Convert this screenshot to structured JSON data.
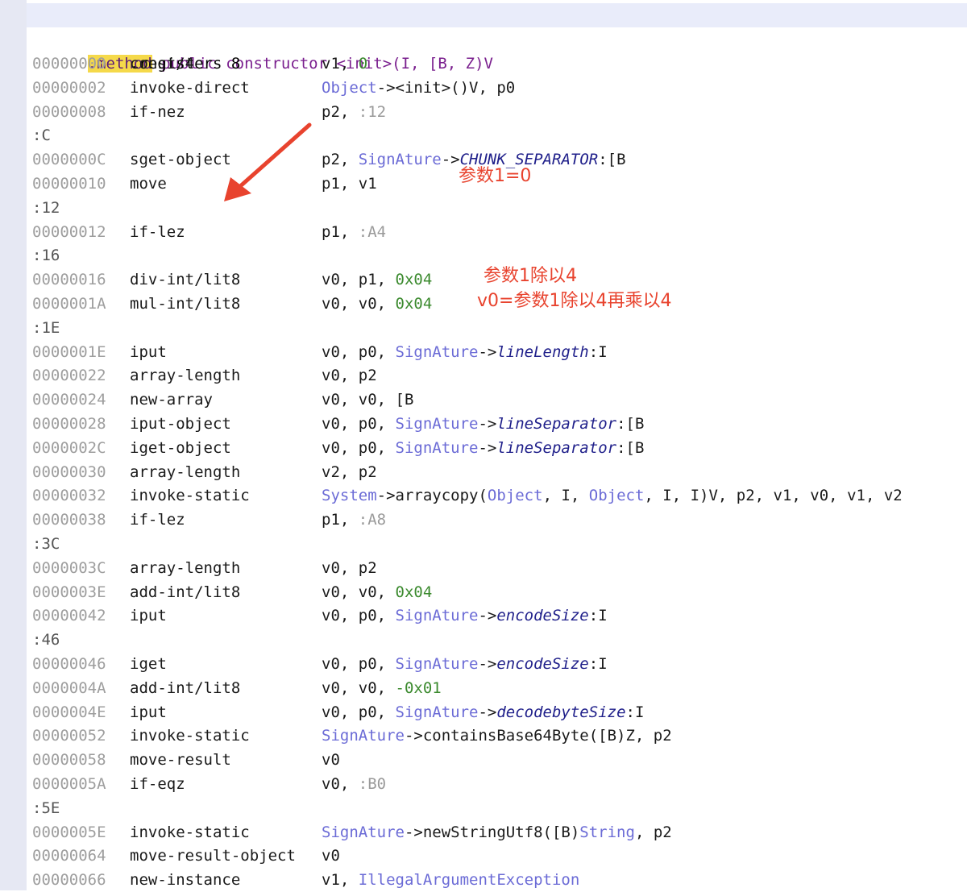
{
  "header": {
    "directive": ".method",
    "signature": " public constructor <init>(I, [B, Z)V",
    "registers": ".registers 8"
  },
  "rows": [
    {
      "addr": "00000000",
      "op": "const/4",
      "args": [
        {
          "t": "v1, "
        },
        {
          "t": "0",
          "c": "num"
        }
      ]
    },
    {
      "addr": "00000002",
      "op": "invoke-direct",
      "args": [
        {
          "t": "Object",
          "c": "cls"
        },
        {
          "t": "-><init>()V, p0"
        }
      ]
    },
    {
      "addr": "00000008",
      "op": "if-nez",
      "args": [
        {
          "t": "p2, "
        },
        {
          "t": ":12",
          "c": "lbl"
        }
      ]
    },
    {
      "label": ":C"
    },
    {
      "addr": "0000000C",
      "op": "sget-object",
      "args": [
        {
          "t": "p2, "
        },
        {
          "t": "SignAture",
          "c": "cls"
        },
        {
          "t": "->"
        },
        {
          "t": "CHUNK_SEPARATOR",
          "c": "fld"
        },
        {
          "t": ":[B"
        }
      ]
    },
    {
      "addr": "00000010",
      "op": "move",
      "args": [
        {
          "t": "p1, v1"
        }
      ]
    },
    {
      "label": ":12"
    },
    {
      "addr": "00000012",
      "op": "if-lez",
      "args": [
        {
          "t": "p1, "
        },
        {
          "t": ":A4",
          "c": "lbl"
        }
      ]
    },
    {
      "label": ":16"
    },
    {
      "addr": "00000016",
      "op": "div-int/lit8",
      "args": [
        {
          "t": "v0, p1, "
        },
        {
          "t": "0x04",
          "c": "num"
        }
      ]
    },
    {
      "addr": "0000001A",
      "op": "mul-int/lit8",
      "args": [
        {
          "t": "v0, v0, "
        },
        {
          "t": "0x04",
          "c": "num"
        }
      ]
    },
    {
      "label": ":1E"
    },
    {
      "addr": "0000001E",
      "op": "iput",
      "args": [
        {
          "t": "v0, p0, "
        },
        {
          "t": "SignAture",
          "c": "cls"
        },
        {
          "t": "->"
        },
        {
          "t": "lineLength",
          "c": "fld"
        },
        {
          "t": ":I"
        }
      ]
    },
    {
      "addr": "00000022",
      "op": "array-length",
      "args": [
        {
          "t": "v0, p2"
        }
      ]
    },
    {
      "addr": "00000024",
      "op": "new-array",
      "args": [
        {
          "t": "v0, v0, [B"
        }
      ]
    },
    {
      "addr": "00000028",
      "op": "iput-object",
      "args": [
        {
          "t": "v0, p0, "
        },
        {
          "t": "SignAture",
          "c": "cls"
        },
        {
          "t": "->"
        },
        {
          "t": "lineSeparator",
          "c": "fld"
        },
        {
          "t": ":[B"
        }
      ]
    },
    {
      "addr": "0000002C",
      "op": "iget-object",
      "args": [
        {
          "t": "v0, p0, "
        },
        {
          "t": "SignAture",
          "c": "cls"
        },
        {
          "t": "->"
        },
        {
          "t": "lineSeparator",
          "c": "fld"
        },
        {
          "t": ":[B"
        }
      ]
    },
    {
      "addr": "00000030",
      "op": "array-length",
      "args": [
        {
          "t": "v2, p2"
        }
      ]
    },
    {
      "addr": "00000032",
      "op": "invoke-static",
      "args": [
        {
          "t": "System",
          "c": "cls"
        },
        {
          "t": "->arraycopy("
        },
        {
          "t": "Object",
          "c": "cls"
        },
        {
          "t": ", I, "
        },
        {
          "t": "Object",
          "c": "cls"
        },
        {
          "t": ", I, I)V, p2, v1, v0, v1, v2"
        }
      ]
    },
    {
      "addr": "00000038",
      "op": "if-lez",
      "args": [
        {
          "t": "p1, "
        },
        {
          "t": ":A8",
          "c": "lbl"
        }
      ]
    },
    {
      "label": ":3C"
    },
    {
      "addr": "0000003C",
      "op": "array-length",
      "args": [
        {
          "t": "v0, p2"
        }
      ]
    },
    {
      "addr": "0000003E",
      "op": "add-int/lit8",
      "args": [
        {
          "t": "v0, v0, "
        },
        {
          "t": "0x04",
          "c": "num"
        }
      ]
    },
    {
      "addr": "00000042",
      "op": "iput",
      "args": [
        {
          "t": "v0, p0, "
        },
        {
          "t": "SignAture",
          "c": "cls"
        },
        {
          "t": "->"
        },
        {
          "t": "encodeSize",
          "c": "fld"
        },
        {
          "t": ":I"
        }
      ]
    },
    {
      "label": ":46"
    },
    {
      "addr": "00000046",
      "op": "iget",
      "args": [
        {
          "t": "v0, p0, "
        },
        {
          "t": "SignAture",
          "c": "cls"
        },
        {
          "t": "->"
        },
        {
          "t": "encodeSize",
          "c": "fld"
        },
        {
          "t": ":I"
        }
      ]
    },
    {
      "addr": "0000004A",
      "op": "add-int/lit8",
      "args": [
        {
          "t": "v0, v0, "
        },
        {
          "t": "-0x01",
          "c": "num"
        }
      ]
    },
    {
      "addr": "0000004E",
      "op": "iput",
      "args": [
        {
          "t": "v0, p0, "
        },
        {
          "t": "SignAture",
          "c": "cls"
        },
        {
          "t": "->"
        },
        {
          "t": "decodebyteSize",
          "c": "fld"
        },
        {
          "t": ":I"
        }
      ]
    },
    {
      "addr": "00000052",
      "op": "invoke-static",
      "args": [
        {
          "t": "SignAture",
          "c": "cls"
        },
        {
          "t": "->containsBase64Byte([B)Z, p2"
        }
      ]
    },
    {
      "addr": "00000058",
      "op": "move-result",
      "args": [
        {
          "t": "v0"
        }
      ]
    },
    {
      "addr": "0000005A",
      "op": "if-eqz",
      "args": [
        {
          "t": "v0, "
        },
        {
          "t": ":B0",
          "c": "lbl"
        }
      ]
    },
    {
      "label": ":5E"
    },
    {
      "addr": "0000005E",
      "op": "invoke-static",
      "args": [
        {
          "t": "SignAture",
          "c": "cls"
        },
        {
          "t": "->newStringUtf8([B)"
        },
        {
          "t": "String",
          "c": "cls"
        },
        {
          "t": ", p2"
        }
      ]
    },
    {
      "addr": "00000064",
      "op": "move-result-object",
      "args": [
        {
          "t": "v0"
        }
      ]
    },
    {
      "addr": "00000066",
      "op": "new-instance",
      "args": [
        {
          "t": "v1, "
        },
        {
          "t": "IllegalArgumentException",
          "c": "cls"
        }
      ]
    }
  ],
  "annotations": {
    "param1_zero": "参数1=0",
    "param1_div4": "参数1除以4",
    "v0_formula": "v0=参数1除以4再乘以4"
  },
  "colors": {
    "annotation": "#e8432e",
    "class_ref": "#6b6bd6",
    "number": "#3b8a2e",
    "address": "#9e9e9e",
    "directive_highlight": "#f5d94a"
  }
}
